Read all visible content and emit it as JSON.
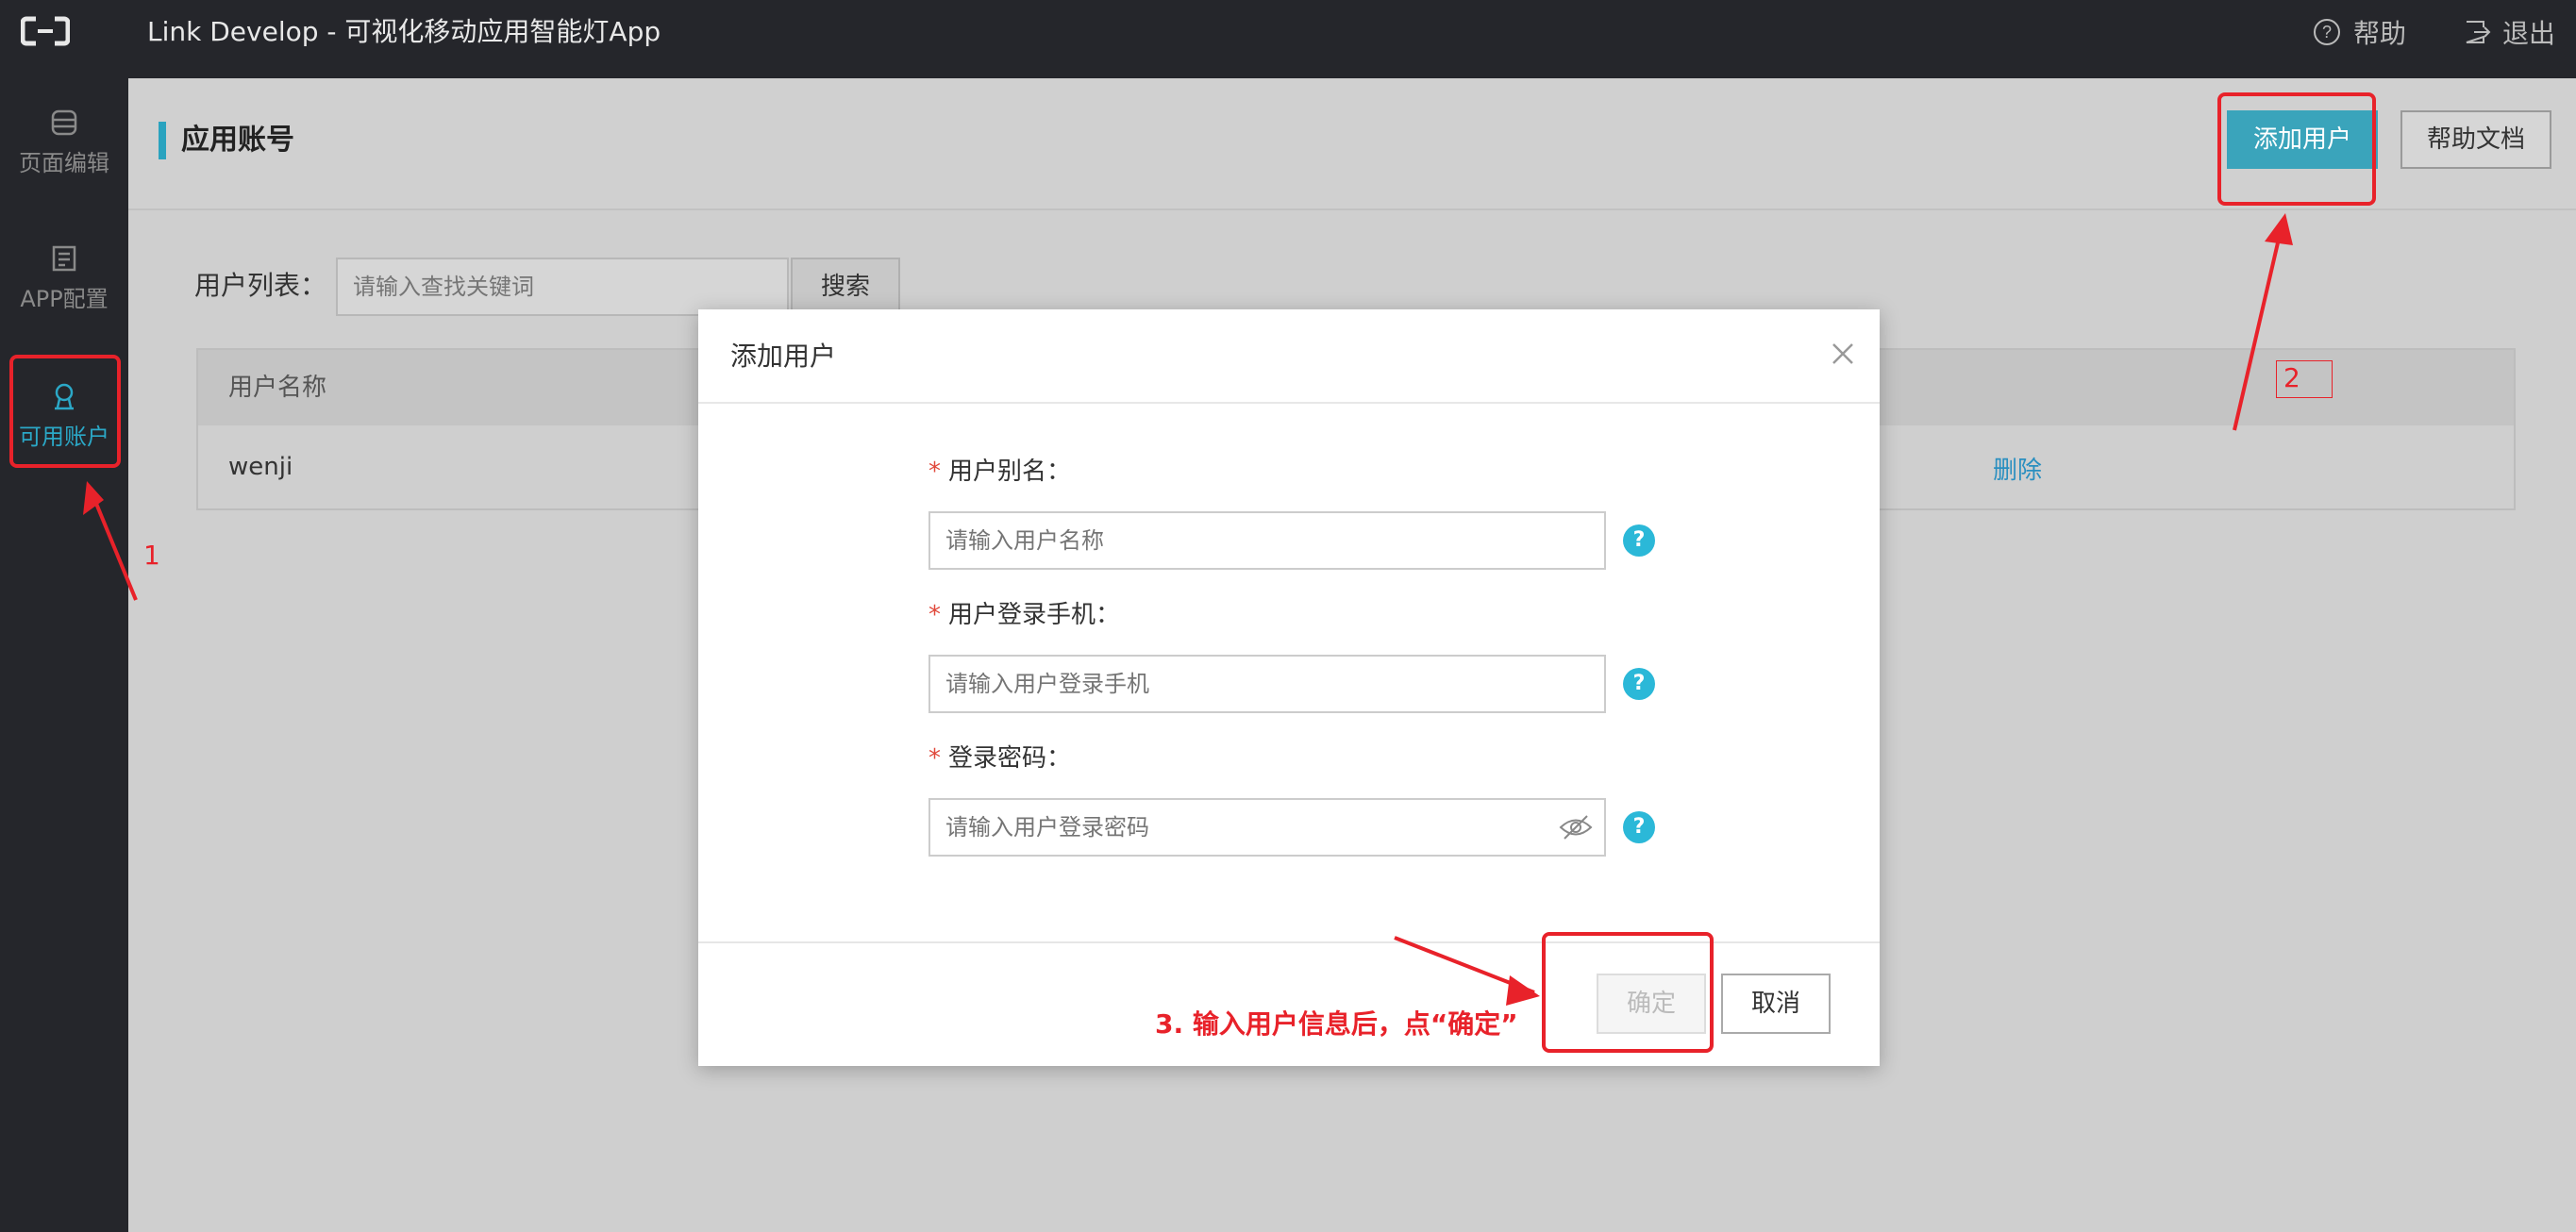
{
  "topbar": {
    "title": "Link Develop - 可视化移动应用智能灯App",
    "help_label": "帮助",
    "logout_label": "退出"
  },
  "sidebar": {
    "items": [
      {
        "label": "页面编辑",
        "icon": "database-icon"
      },
      {
        "label": "APP配置",
        "icon": "document-icon"
      },
      {
        "label": "可用账户",
        "icon": "user-icon",
        "active": true
      }
    ]
  },
  "page": {
    "title": "应用账号",
    "add_user_label": "添加用户",
    "help_docs_label": "帮助文档",
    "list_label": "用户列表：",
    "search_placeholder": "请输入查找关键词",
    "search_label": "搜索"
  },
  "table": {
    "columns": [
      "用户名称"
    ],
    "rows": [
      {
        "name": "wenji",
        "action": "删除"
      }
    ]
  },
  "modal": {
    "title": "添加用户",
    "fields": [
      {
        "label": "用户别名：",
        "placeholder": "请输入用户名称"
      },
      {
        "label": "用户登录手机：",
        "placeholder": "请输入用户登录手机"
      },
      {
        "label": "登录密码：",
        "placeholder": "请输入用户登录密码"
      }
    ],
    "ok_label": "确定",
    "cancel_label": "取消"
  },
  "annotations": {
    "step1": "1",
    "step2": "2",
    "step3": "3. 输入用户信息后，点“确定”",
    "color": "#e8222a"
  },
  "colors": {
    "accent": "#3aa4bb",
    "topbar_bg": "#25262b",
    "link": "#2a8fc0"
  }
}
